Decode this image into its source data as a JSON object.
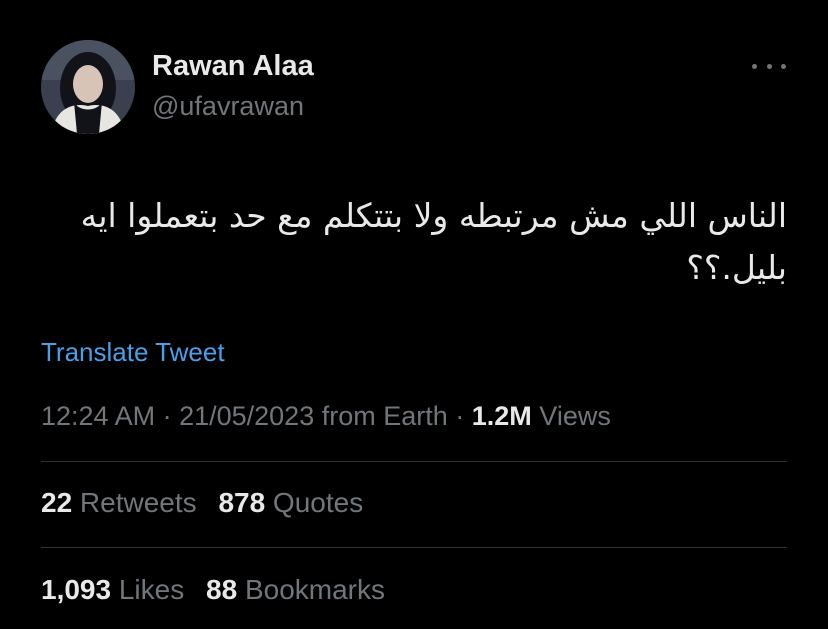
{
  "author": {
    "name": "Rawan Alaa",
    "handle": "@ufavrawan"
  },
  "tweet": {
    "text_line1": "الناس اللي مش مرتبطه ولا بتتكلم مع حد بتعملوا ايه",
    "text_line2": "بليل.؟؟",
    "translate_label": "Translate Tweet"
  },
  "meta": {
    "time": "12:24 AM",
    "sep1": " · ",
    "date": "21/05/2023",
    "source": " from Earth",
    "sep2": " · ",
    "views_count": "1.2M",
    "views_label": " Views"
  },
  "stats": {
    "retweets_count": "22",
    "retweets_label": " Retweets",
    "quotes_count": "878",
    "quotes_label": " Quotes",
    "likes_count": "1,093",
    "likes_label": " Likes",
    "bookmarks_count": "88",
    "bookmarks_label": " Bookmarks"
  },
  "icons": {
    "avatar": "avatar-photo",
    "more": "more-options-icon"
  },
  "colors": {
    "background": "#000000",
    "primary_text": "#e7e9ea",
    "secondary_text": "#71767b",
    "link": "#4a9fe8",
    "divider": "#2f3336"
  }
}
